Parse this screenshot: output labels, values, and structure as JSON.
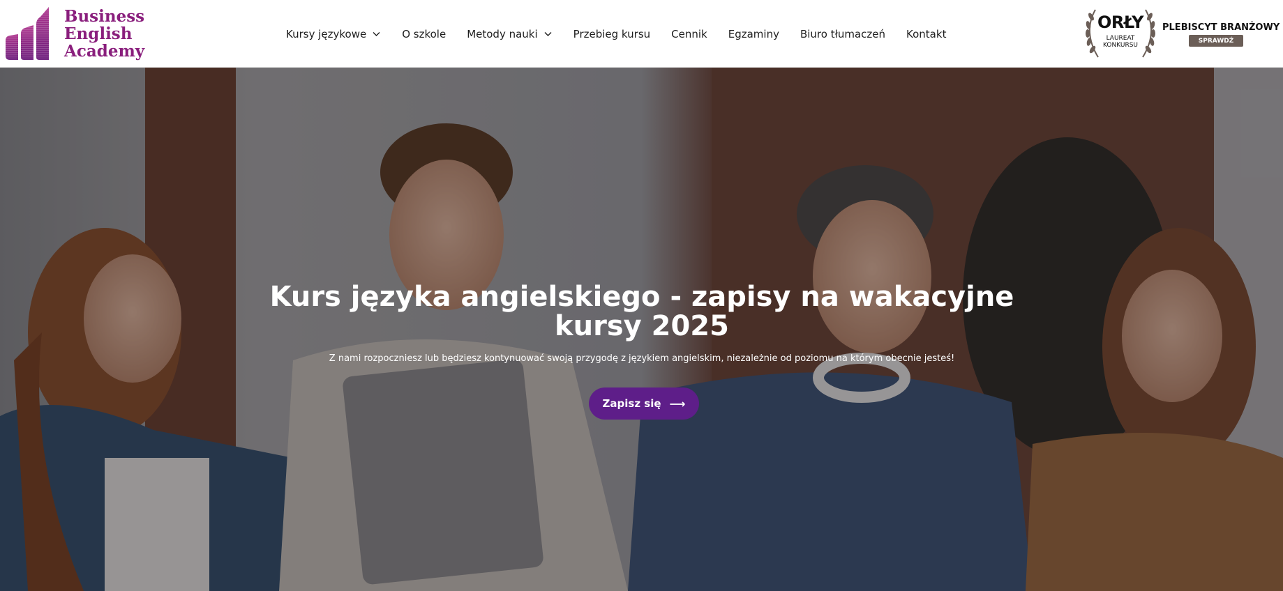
{
  "logo": {
    "line1": "Business",
    "line2": "English",
    "line3": "Academy",
    "icon": "bar-chart-logo-icon",
    "color": "#8a1f7d"
  },
  "nav": {
    "items": [
      {
        "label": "Kursy językowe",
        "has_dropdown": true
      },
      {
        "label": "O szkole",
        "has_dropdown": false
      },
      {
        "label": "Metody nauki",
        "has_dropdown": true
      },
      {
        "label": "Przebieg kursu",
        "has_dropdown": false
      },
      {
        "label": "Cennik",
        "has_dropdown": false
      },
      {
        "label": "Egzaminy",
        "has_dropdown": false
      },
      {
        "label": "Biuro tłumaczeń",
        "has_dropdown": false
      },
      {
        "label": "Kontakt",
        "has_dropdown": false
      }
    ]
  },
  "award": {
    "title": "ORŁY",
    "sub1": "LAUREAT",
    "sub2": "KONKURSU",
    "plebiscyt": "PLEBISCYT BRANŻOWY",
    "button": "SPRAWDŹ",
    "icon": "laurel-wreath-icon"
  },
  "hero": {
    "title": "Kurs języka angielskiego - zapisy na wakacyjne kursy 2025",
    "subtitle": "Z nami rozpoczniesz lub będziesz kontynuować swoją przygodę z językiem angielskim, niezależnie od poziomu na którym obecnie jesteś!",
    "cta_label": "Zapisz się",
    "cta_icon": "arrow-right-icon",
    "cta_color": "#5e1e89"
  }
}
